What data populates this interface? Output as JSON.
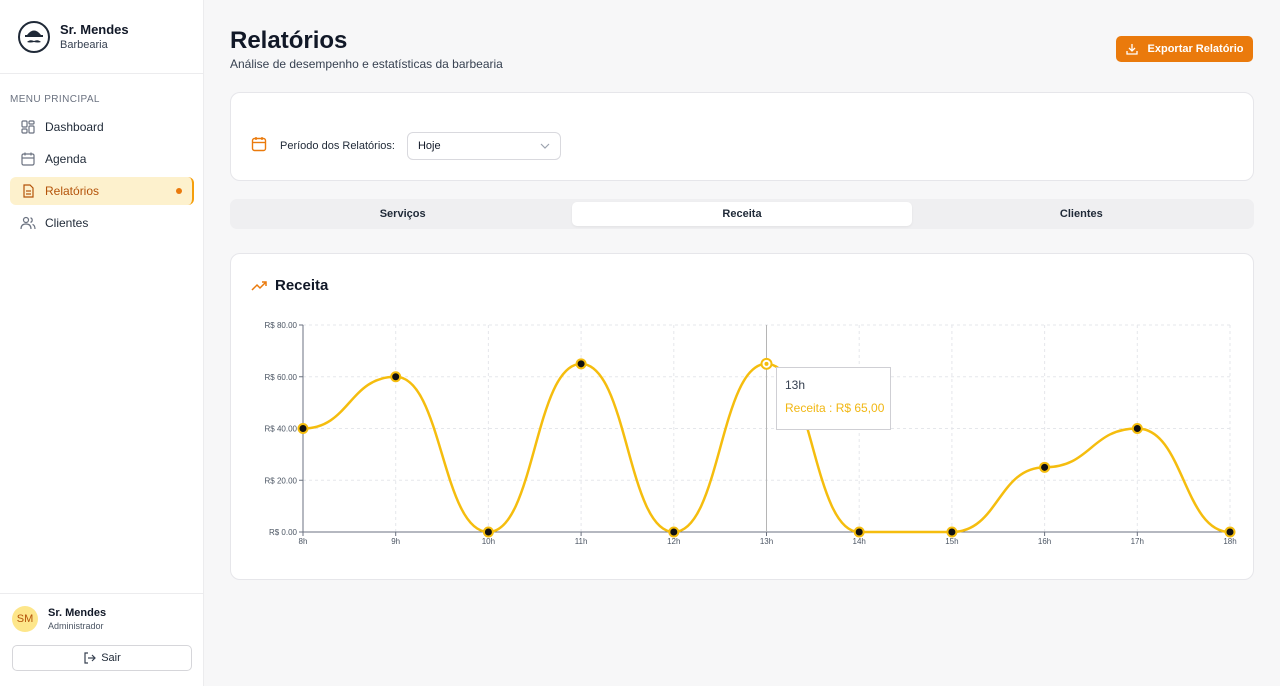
{
  "brand": {
    "name": "Sr. Mendes",
    "subtitle": "Barbearia",
    "logo_icon": "mustache-hat-icon"
  },
  "sidebar": {
    "menu_title": "MENU PRINCIPAL",
    "items": [
      {
        "label": "Dashboard",
        "icon": "grid-icon",
        "active": false
      },
      {
        "label": "Agenda",
        "icon": "calendar-icon",
        "active": false
      },
      {
        "label": "Relatórios",
        "icon": "file-text-icon",
        "active": true
      },
      {
        "label": "Clientes",
        "icon": "users-icon",
        "active": false
      }
    ]
  },
  "user": {
    "initials": "SM",
    "name": "Sr. Mendes",
    "role": "Administrador",
    "logout_label": "Sair"
  },
  "header": {
    "title": "Relatórios",
    "subtitle": "Análise de desempenho e estatísticas da barbearia",
    "export_label": "Exportar Relatório"
  },
  "filter": {
    "label": "Período dos Relatórios:",
    "selected": "Hoje"
  },
  "tabs": [
    {
      "label": "Serviços",
      "active": false
    },
    {
      "label": "Receita",
      "active": true
    },
    {
      "label": "Clientes",
      "active": false
    }
  ],
  "chart_card": {
    "title": "Receita"
  },
  "tooltip": {
    "label": "13h",
    "value": "Receita : R$ 65,00"
  },
  "colors": {
    "accent": "#ea7a0c",
    "line": "#f5bd0e",
    "active_bg": "#fdf1cd"
  },
  "chart_data": {
    "type": "line",
    "curve": "smooth",
    "categories": [
      "8h",
      "9h",
      "10h",
      "11h",
      "12h",
      "13h",
      "14h",
      "15h",
      "16h",
      "17h",
      "18h"
    ],
    "series": [
      {
        "name": "Receita",
        "values": [
          40,
          60,
          0,
          65,
          0,
          65,
          0,
          0,
          25,
          40,
          0
        ]
      }
    ],
    "y_ticks": [
      "R$ 0.00",
      "R$ 20.00",
      "R$ 40.00",
      "R$ 60.00",
      "R$ 80.00"
    ],
    "ylim": [
      0,
      80
    ],
    "grid": true,
    "highlighted_category": "13h"
  }
}
